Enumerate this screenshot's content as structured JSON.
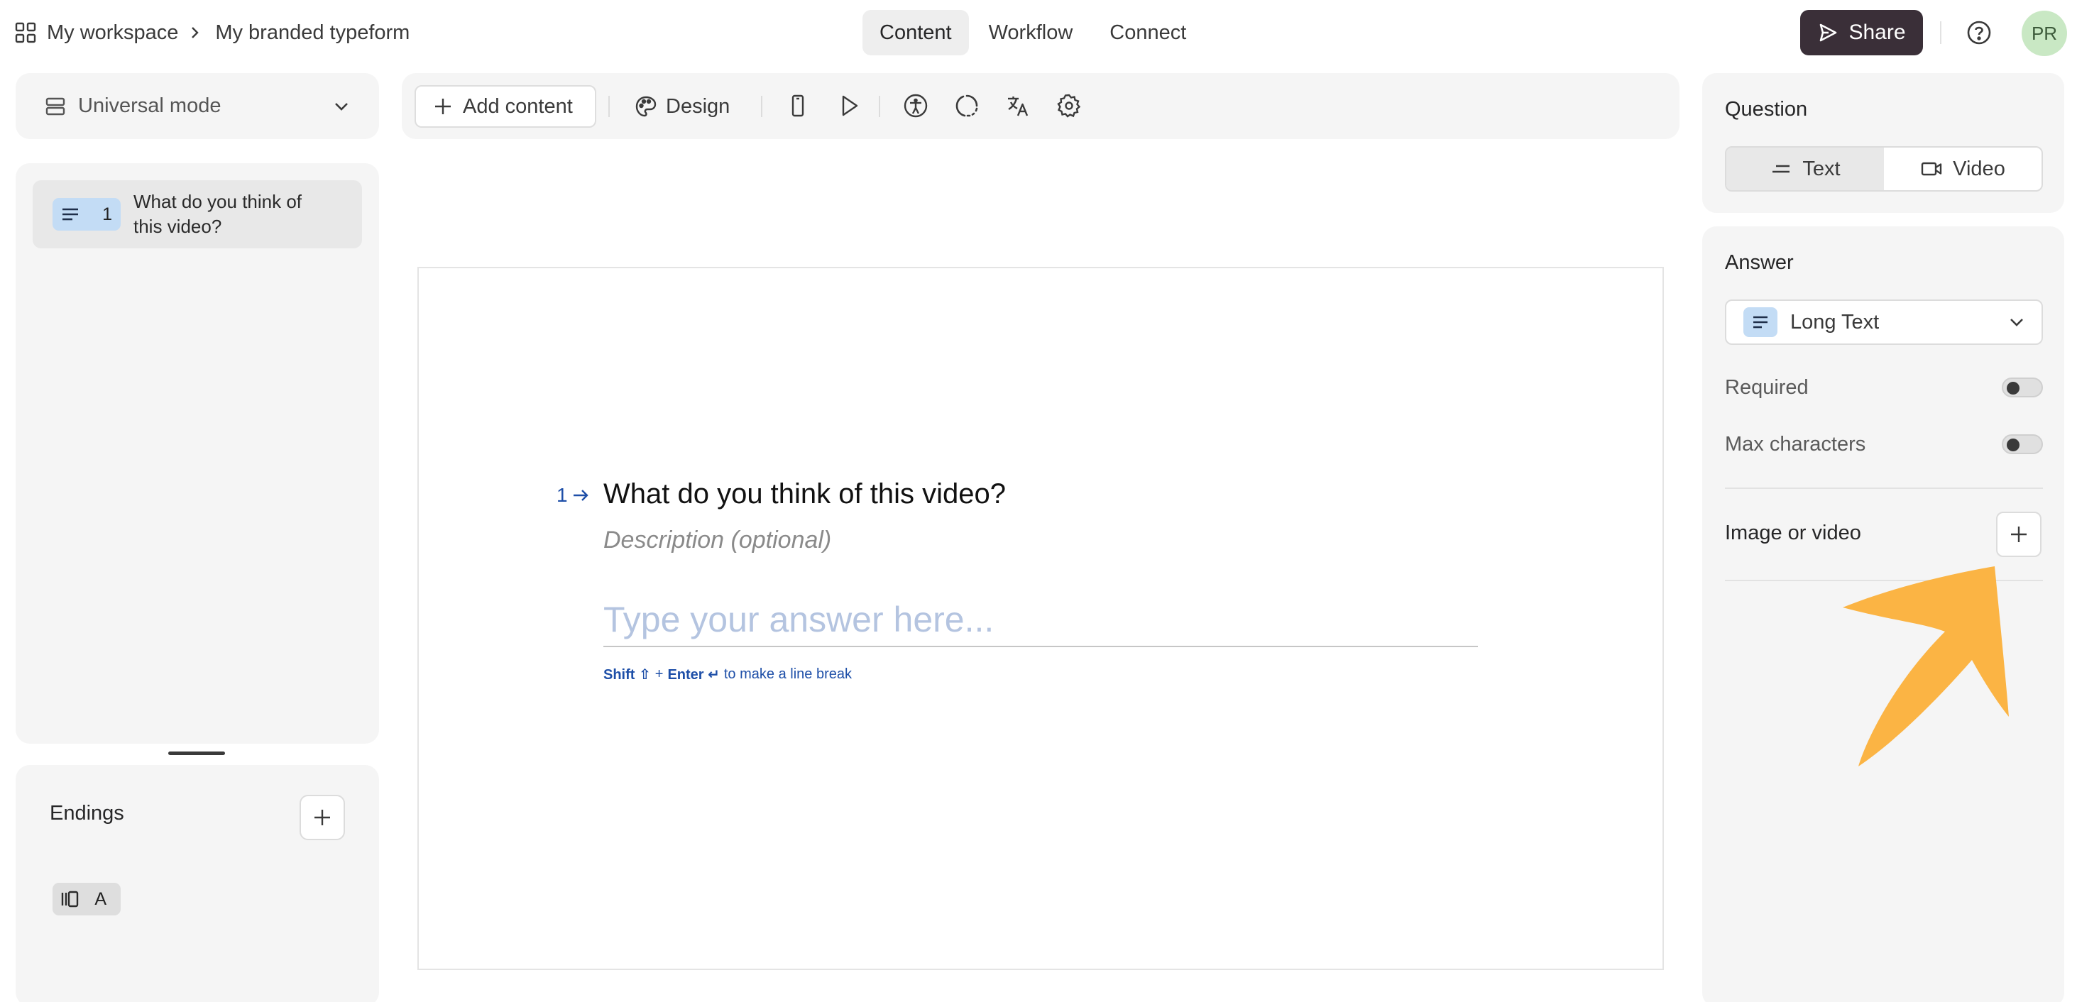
{
  "header": {
    "breadcrumb": [
      "My workspace",
      "My branded typeform"
    ],
    "tabs": [
      "Content",
      "Workflow",
      "Connect"
    ],
    "active_tab": "Content",
    "share_label": "Share",
    "avatar_initials": "PR"
  },
  "sidebar": {
    "mode_label": "Universal mode",
    "questions": [
      {
        "number": "1",
        "text": "What do you think of this video?",
        "icon": "long-text-icon"
      }
    ],
    "endings_title": "Endings",
    "endings": [
      {
        "label": "A",
        "icon": "ending-icon"
      }
    ]
  },
  "toolbar": {
    "add_content_label": "Add content",
    "design_label": "Design",
    "icons": [
      "mobile-preview-icon",
      "play-icon",
      "accessibility-icon",
      "loading-icon",
      "translate-icon",
      "settings-icon"
    ]
  },
  "canvas": {
    "question_number": "1",
    "question_title": "What do you think of this video?",
    "description_placeholder": "Description (optional)",
    "answer_placeholder": "Type your answer here...",
    "hint_shift": "Shift ⇧",
    "hint_plus": "+",
    "hint_enter": "Enter ↵",
    "hint_rest": "to make a line break"
  },
  "settings": {
    "question_title": "Question",
    "question_modes": [
      "Text",
      "Video"
    ],
    "active_mode": "Text",
    "answer_title": "Answer",
    "answer_type": "Long Text",
    "required_label": "Required",
    "required_on": false,
    "max_chars_label": "Max characters",
    "max_chars_on": false,
    "media_title": "Image or video"
  },
  "colors": {
    "accent_blue": "#1e4fa8",
    "badge_blue": "#c3dcf5",
    "share_bg": "#3a2f38",
    "annotation_arrow": "#fbb444",
    "avatar_bg": "#c9e8c4"
  }
}
